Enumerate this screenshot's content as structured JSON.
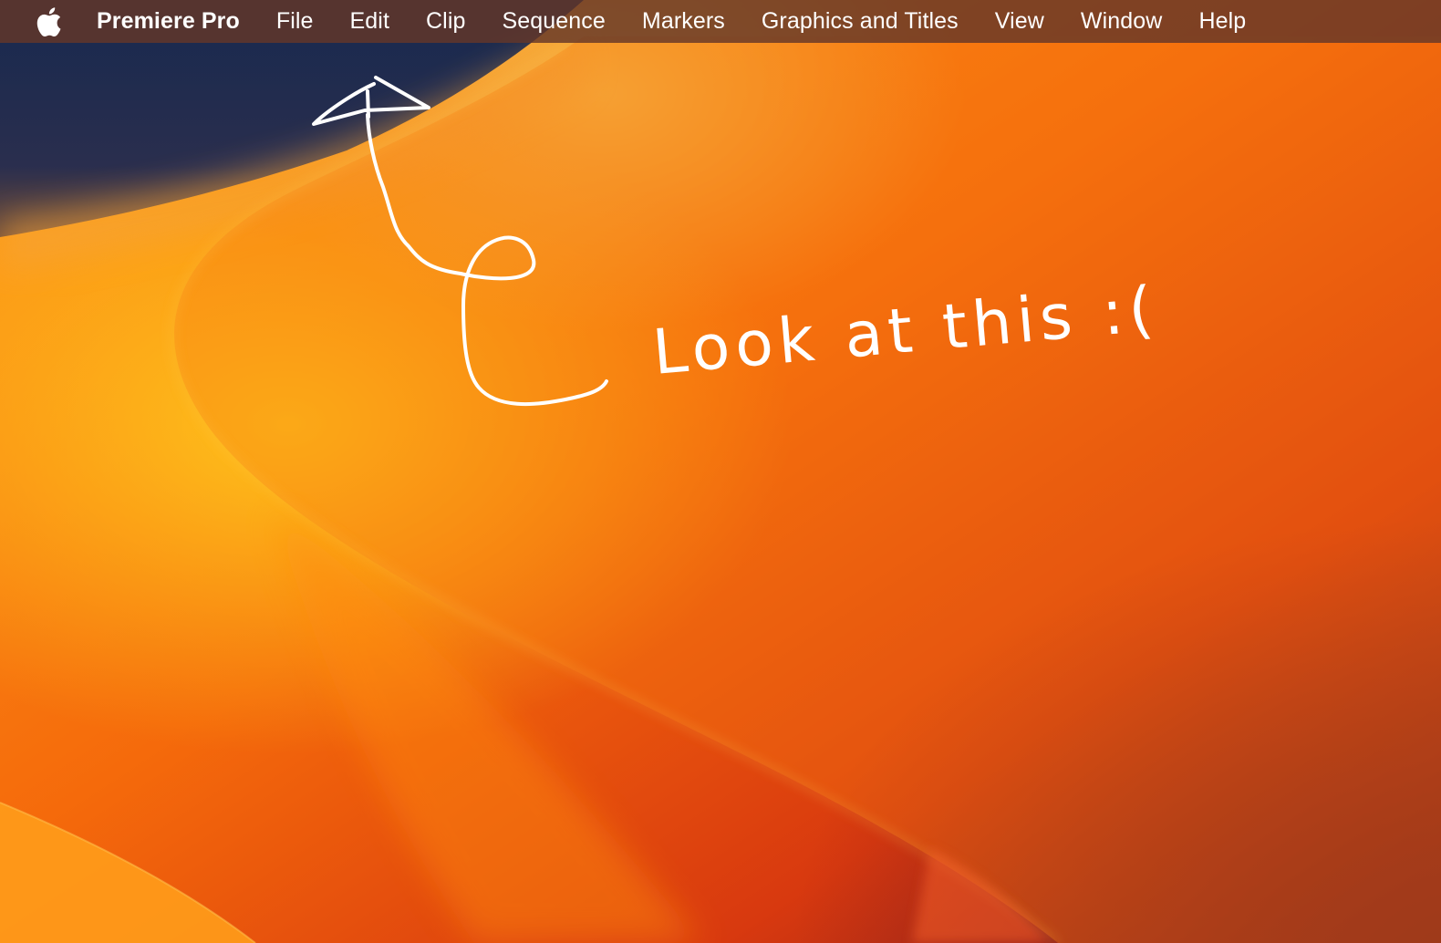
{
  "menubar": {
    "apple_icon": "apple-logo-icon",
    "app_name": "Premiere Pro",
    "items": [
      {
        "label": "File"
      },
      {
        "label": "Edit"
      },
      {
        "label": "Clip"
      },
      {
        "label": "Sequence"
      },
      {
        "label": "Markers"
      },
      {
        "label": "Graphics and Titles"
      },
      {
        "label": "View"
      },
      {
        "label": "Window"
      },
      {
        "label": "Help"
      }
    ]
  },
  "annotation": {
    "handwritten_text": "Look at this :(",
    "icon": "arrow-up-icon",
    "color": "#ffffff"
  },
  "wallpaper": {
    "colors": {
      "navy": "#1b2c52",
      "yellow": "#ffc21a",
      "orange": "#ff7a08",
      "red_orange": "#e8430f",
      "dark_red": "#8c1d1d"
    }
  }
}
